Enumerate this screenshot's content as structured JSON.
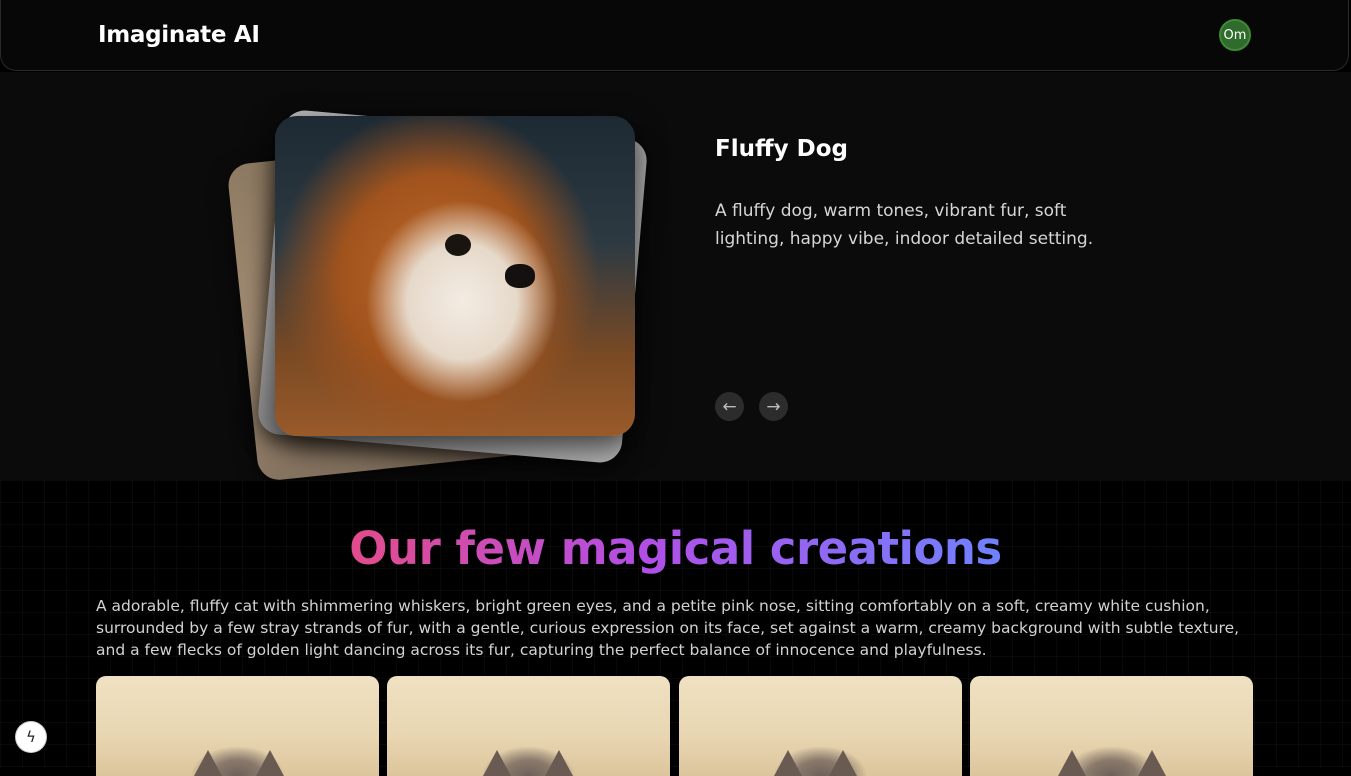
{
  "header": {
    "brand": "Imaginate AI",
    "avatar_initials": "Om",
    "avatar_color": "#2f6b2a"
  },
  "hero": {
    "title": "Fluffy Dog",
    "description": "A fluffy dog, warm tones, vibrant fur, soft lighting, happy vibe, indoor detailed setting.",
    "prev_icon": "←",
    "next_icon": "→",
    "image_subject": "dog"
  },
  "gallery": {
    "title": "Our few magical creations",
    "title_gradient": [
      "#e34c8c",
      "#b24ee6",
      "#6f82ff"
    ],
    "prompt": "A adorable, fluffy cat with shimmering whiskers, bright green eyes, and a petite pink nose, sitting comfortably on a soft, creamy white cushion, surrounded by a few stray strands of fur, with a gentle, curious expression on its face, set against a warm, creamy background with subtle texture, and a few flecks of golden light dancing across its fur, capturing the perfect balance of innocence and playfulness.",
    "images": [
      {
        "subject": "cat"
      },
      {
        "subject": "cat"
      },
      {
        "subject": "cat"
      },
      {
        "subject": "cat"
      }
    ]
  },
  "floating_button": {
    "icon": "lightning-icon",
    "glyph": "ϟ"
  }
}
